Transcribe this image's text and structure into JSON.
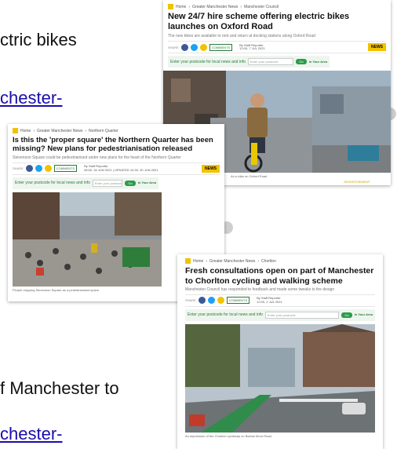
{
  "background": {
    "line1": "ctric bikes",
    "line2": "chester-",
    "line3": "f Manchester to",
    "line4": "chester-"
  },
  "card1": {
    "crumbs": [
      "Home",
      "Greater Manchester News",
      "Manchester Council"
    ],
    "title": "New 24/7 hire scheme offering electric bikes launches on Oxford Road",
    "sub": "The new bikes are available to rent and return at docking stations along Oxford Road",
    "share": "SHARE",
    "comments": "COMMENTS",
    "byline1": "By Staff Reporter",
    "byline2": "12:00, 7 JUL 2021",
    "news_label": "NEWS",
    "postcode_label": "Enter your postcode for local news and info",
    "postcode_placeholder": "Enter your postcode",
    "go": "Go",
    "brand": "In Your Area",
    "caption": "An e-bike on Oxford Road",
    "corner_label": "ADVERTISEMENT"
  },
  "card2": {
    "crumbs": [
      "Home",
      "Greater Manchester News",
      "Northern Quarter"
    ],
    "title": "Is this the 'proper square' the Northern Quarter has been missing? New plans for pedestrianisation released",
    "sub": "Stevenson Square could be pedestrianised under new plans for the heart of the Northern Quarter",
    "share": "SHARE",
    "comments": "COMMENTS",
    "byline1": "By Staff Reporter",
    "byline2": "06:00, 30 JUN 2021 | UPDATED 10:33, 30 JUN 2021",
    "news_label": "NEWS",
    "postcode_label": "Enter your postcode for local news and info",
    "postcode_placeholder": "Enter your postcode",
    "go": "Go",
    "brand": "In Your Area",
    "caption": "People enjoying Stevenson Square as a pedestrianised space"
  },
  "card3": {
    "crumbs": [
      "Home",
      "Greater Manchester News",
      "Chorlton"
    ],
    "title": "Fresh consultations open on part of Manchester to Chorlton cycling and walking scheme",
    "sub": "Manchester Council has responded to feedback and made some tweaks to the design",
    "share": "SHARE",
    "comments": "COMMENTS",
    "byline1": "By Staff Reporter",
    "byline2": "12:00, 2 JUL 2021",
    "postcode_label": "Enter your postcode for local news and info",
    "postcode_placeholder": "Enter your postcode",
    "go": "Go",
    "brand": "In Your Area",
    "caption": "An impression of the Chorlton cycleway on Barlow Moor Road"
  },
  "colors": {
    "brand_yellow": "#f2c200",
    "link_blue": "#1a0dab",
    "green": "#2a9d4a"
  }
}
